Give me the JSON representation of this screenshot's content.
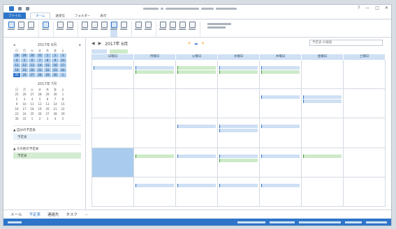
{
  "titlebar": {
    "controls": [
      "?",
      "—",
      "□",
      "✕"
    ]
  },
  "ribbon_tabs": [
    {
      "label": "ファイル",
      "active": false,
      "file": true
    },
    {
      "label": "ホーム",
      "active": true,
      "file": false
    },
    {
      "label": "送受信",
      "active": false,
      "file": false
    },
    {
      "label": "フォルダー",
      "active": false,
      "file": false
    },
    {
      "label": "表示",
      "active": false,
      "file": false
    }
  ],
  "calendar_nav": {
    "month_title": "2017年 6月",
    "prev": "◀",
    "next": "▶",
    "weather_sun": "☀",
    "weather_cloud": "☁",
    "search_placeholder": "予定表 の検索"
  },
  "day_headers": [
    "日曜日",
    "月曜日",
    "火曜日",
    "水曜日",
    "木曜日",
    "金曜日",
    "土曜日"
  ],
  "mini_calendar_1": {
    "title": "2017年 6月",
    "weekdays": [
      "日",
      "月",
      "火",
      "水",
      "木",
      "金",
      "土"
    ],
    "days": [
      "28",
      "29",
      "30",
      "31",
      "1",
      "2",
      "3",
      "4",
      "5",
      "6",
      "7",
      "8",
      "9",
      "10",
      "11",
      "12",
      "13",
      "14",
      "15",
      "16",
      "17",
      "18",
      "19",
      "20",
      "21",
      "22",
      "23",
      "24",
      "25",
      "26",
      "27",
      "28",
      "29",
      "30",
      "1"
    ],
    "today_index": 28
  },
  "mini_calendar_2": {
    "title": "2017年 7月",
    "weekdays": [
      "日",
      "月",
      "火",
      "水",
      "木",
      "金",
      "土"
    ],
    "days": [
      "25",
      "26",
      "27",
      "28",
      "29",
      "30",
      "1",
      "2",
      "3",
      "4",
      "5",
      "6",
      "7",
      "8",
      "9",
      "10",
      "11",
      "12",
      "13",
      "14",
      "15",
      "16",
      "17",
      "18",
      "19",
      "20",
      "21",
      "22",
      "23",
      "24",
      "25",
      "26",
      "27",
      "28",
      "29",
      "30",
      "31",
      "1",
      "2",
      "3",
      "4",
      "5"
    ]
  },
  "folders": {
    "my_calendars_title": "▲ 自分の予定表",
    "calendar_item": "予定表",
    "other_title": "▲ その他の予定表",
    "other_item": "予定表"
  },
  "bottom_nav": {
    "mail": "メール",
    "calendar": "予定表",
    "people": "連絡先",
    "tasks": "タスク",
    "more": "…"
  },
  "colors": {
    "accent": "#2e75c9",
    "event_blue": "#cfe0f4",
    "event_green": "#cdeac8",
    "selected": "#a9cbee"
  }
}
